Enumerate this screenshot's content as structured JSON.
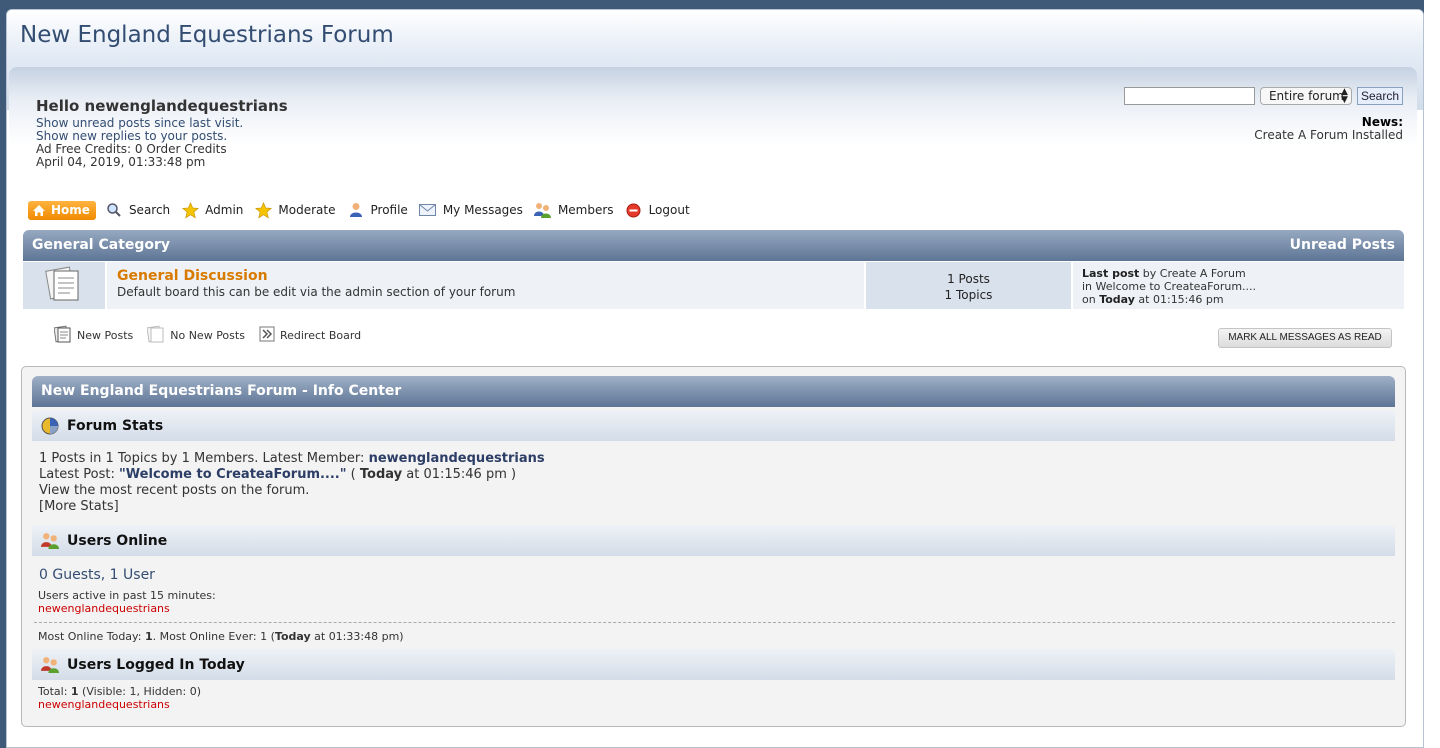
{
  "header": {
    "title": "New England Equestrians Forum"
  },
  "user": {
    "greeting": "Hello newenglandequestrians",
    "unread_link": "Show unread posts since last visit.",
    "replies_link": "Show new replies to your posts.",
    "credits": "Ad Free Credits: 0 Order Credits",
    "datetime": "April 04, 2019, 01:33:48 pm"
  },
  "search": {
    "scope": "Entire forum",
    "button": "Search"
  },
  "news": {
    "label": "News:",
    "text": "Create A Forum Installed"
  },
  "nav": {
    "home": "Home",
    "search": "Search",
    "admin": "Admin",
    "moderate": "Moderate",
    "profile": "Profile",
    "messages": "My Messages",
    "members": "Members",
    "logout": "Logout"
  },
  "category": {
    "title": "General Category",
    "unread": "Unread Posts",
    "board": {
      "name": "General Discussion",
      "description": "Default board this can be edit via the admin section of your forum",
      "posts": "1 Posts",
      "topics": "1 Topics",
      "last_post_label": "Last post",
      "last_post_by": " by Create A Forum",
      "last_post_in": "in Welcome to CreateaForum....",
      "last_post_on": "on ",
      "last_post_today": "Today",
      "last_post_time": " at 01:15:46 pm"
    }
  },
  "legend": {
    "new_posts": "New Posts",
    "no_new_posts": "No New Posts",
    "redirect": "Redirect Board"
  },
  "mark_read": "MARK ALL MESSAGES AS READ",
  "info_center": {
    "title": "New England Equestrians Forum - Info Center",
    "forum_stats": {
      "heading": "Forum Stats",
      "line1_prefix": "1 Posts in 1 Topics by 1 Members. Latest Member: ",
      "latest_member": "newenglandequestrians",
      "line2_prefix": "Latest Post: ",
      "latest_post": "\"Welcome to CreateaForum....\"",
      "line2_mid": " ( ",
      "today": "Today",
      "line2_suffix": " at 01:15:46 pm )",
      "recent_link": "View the most recent posts on the forum.",
      "more_stats": "[More Stats]"
    },
    "users_online": {
      "heading": "Users Online",
      "count": "0 Guests, 1 User",
      "active_label": "Users active in past 15 minutes:",
      "user": "newenglandequestrians",
      "most_online_prefix": "Most Online Today: ",
      "most_today": "1",
      "most_online_mid": ". Most Online Ever: 1 (",
      "today": "Today",
      "most_online_suffix": " at 01:33:48 pm)"
    },
    "logged_today": {
      "heading": "Users Logged In Today",
      "total_prefix": "Total: ",
      "total": "1",
      "total_suffix": " (Visible: 1, Hidden: 0)",
      "user": "newenglandequestrians"
    }
  },
  "colors": {
    "accent": "#f08a00",
    "header_bar": "#5d7595",
    "link": "#334d72",
    "user_red": "#cc0000"
  }
}
